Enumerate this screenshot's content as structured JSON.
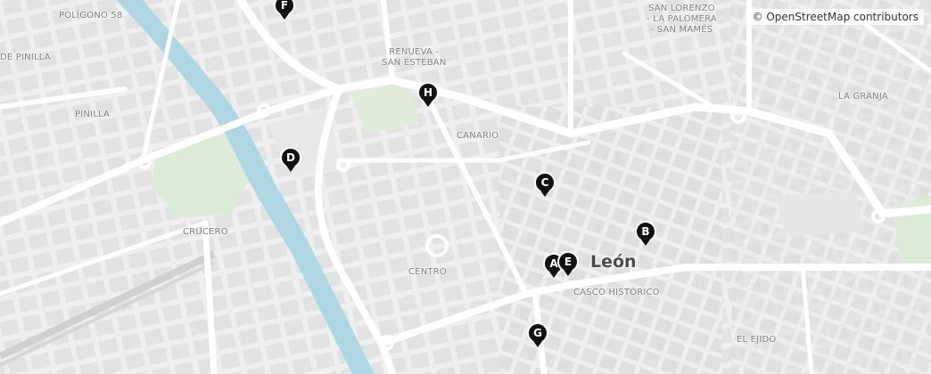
{
  "map": {
    "attribution": "© OpenStreetMap contributors",
    "city": "León",
    "labels": {
      "poligono": "POLÍGONO 58",
      "pinilla_de": "DE PINILLA",
      "pinilla": "PINILLA",
      "crucero": "CRUCERO",
      "renueva": "RENUEVA -\nSAN ESTEBAN",
      "canario": "CANARIO",
      "centro": "CENTRO",
      "san_lorenzo": "SAN LORENZO\n- LA PALOMERA\n- SAN MAMÉS",
      "la_granja": "LA GRANJA",
      "casco": "CASCO HISTÓRICO",
      "el_ejido": "EL EJIDO"
    },
    "markers": [
      "A",
      "B",
      "C",
      "D",
      "E",
      "F",
      "G",
      "H"
    ],
    "colors": {
      "marker": "#111111",
      "river": "#a9d6e5",
      "park": "#d9ead3",
      "road": "#ffffff"
    }
  }
}
